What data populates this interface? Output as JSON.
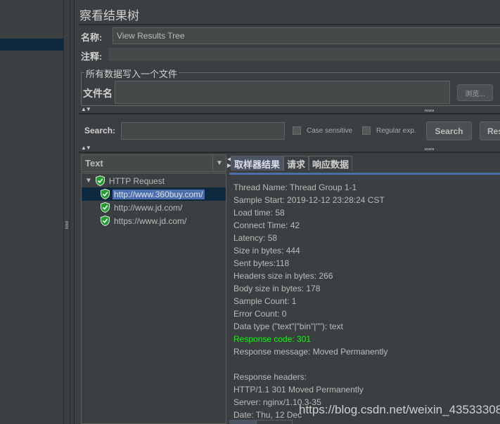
{
  "window_title": "察看结果树",
  "name_label": "名称:",
  "name_value": "View Results Tree",
  "comment_label": "注释:",
  "comment_value": "",
  "file_group_title": "所有数据写入一个文件",
  "filename_label": "文件名",
  "filename_value": "",
  "browse_label": "浏览...",
  "search": {
    "label": "Search:",
    "value": "",
    "case_sensitive_label": "Case sensitive",
    "case_sensitive_checked": false,
    "regex_label": "Regular exp.",
    "regex_checked": false,
    "search_button": "Search",
    "reset_button": "Res"
  },
  "renderer_select": "Text",
  "tree": {
    "root": "HTTP Request",
    "children": [
      {
        "label": "http://www.360buy.com/",
        "selected": true,
        "status": "success"
      },
      {
        "label": "http://www.jd.com/",
        "selected": false,
        "status": "success"
      },
      {
        "label": "https://www.jd.com/",
        "selected": false,
        "status": "success"
      }
    ]
  },
  "tabs": [
    {
      "label": "取样器结果",
      "active": true
    },
    {
      "label": "请求",
      "active": false
    },
    {
      "label": "响应数据",
      "active": false
    }
  ],
  "result_lines": [
    "Thread Name: Thread Group 1-1",
    "Sample Start: 2019-12-12 23:28:24 CST",
    "Load time: 58",
    "Connect Time: 42",
    "Latency: 58",
    "Size in bytes: 444",
    "Sent bytes:118",
    "Headers size in bytes: 266",
    "Body size in bytes: 178",
    "Sample Count: 1",
    "Error Count: 0",
    "Data type (\"text\"|\"bin\"|\"\"): text",
    "Response code: 301",
    "Response message: Moved Permanently",
    "",
    "Response headers:",
    "HTTP/1.1 301 Moved Permanently",
    "Server: nginx/1.10.3-35",
    "Date: Thu, 12 Dec"
  ],
  "highlight_line_index": 12,
  "colors": {
    "response_code": "#00ff00",
    "selection": "#4b6eaf",
    "background": "#3c3f41"
  },
  "watermark": "https://blog.csdn.net/weixin_43533308"
}
